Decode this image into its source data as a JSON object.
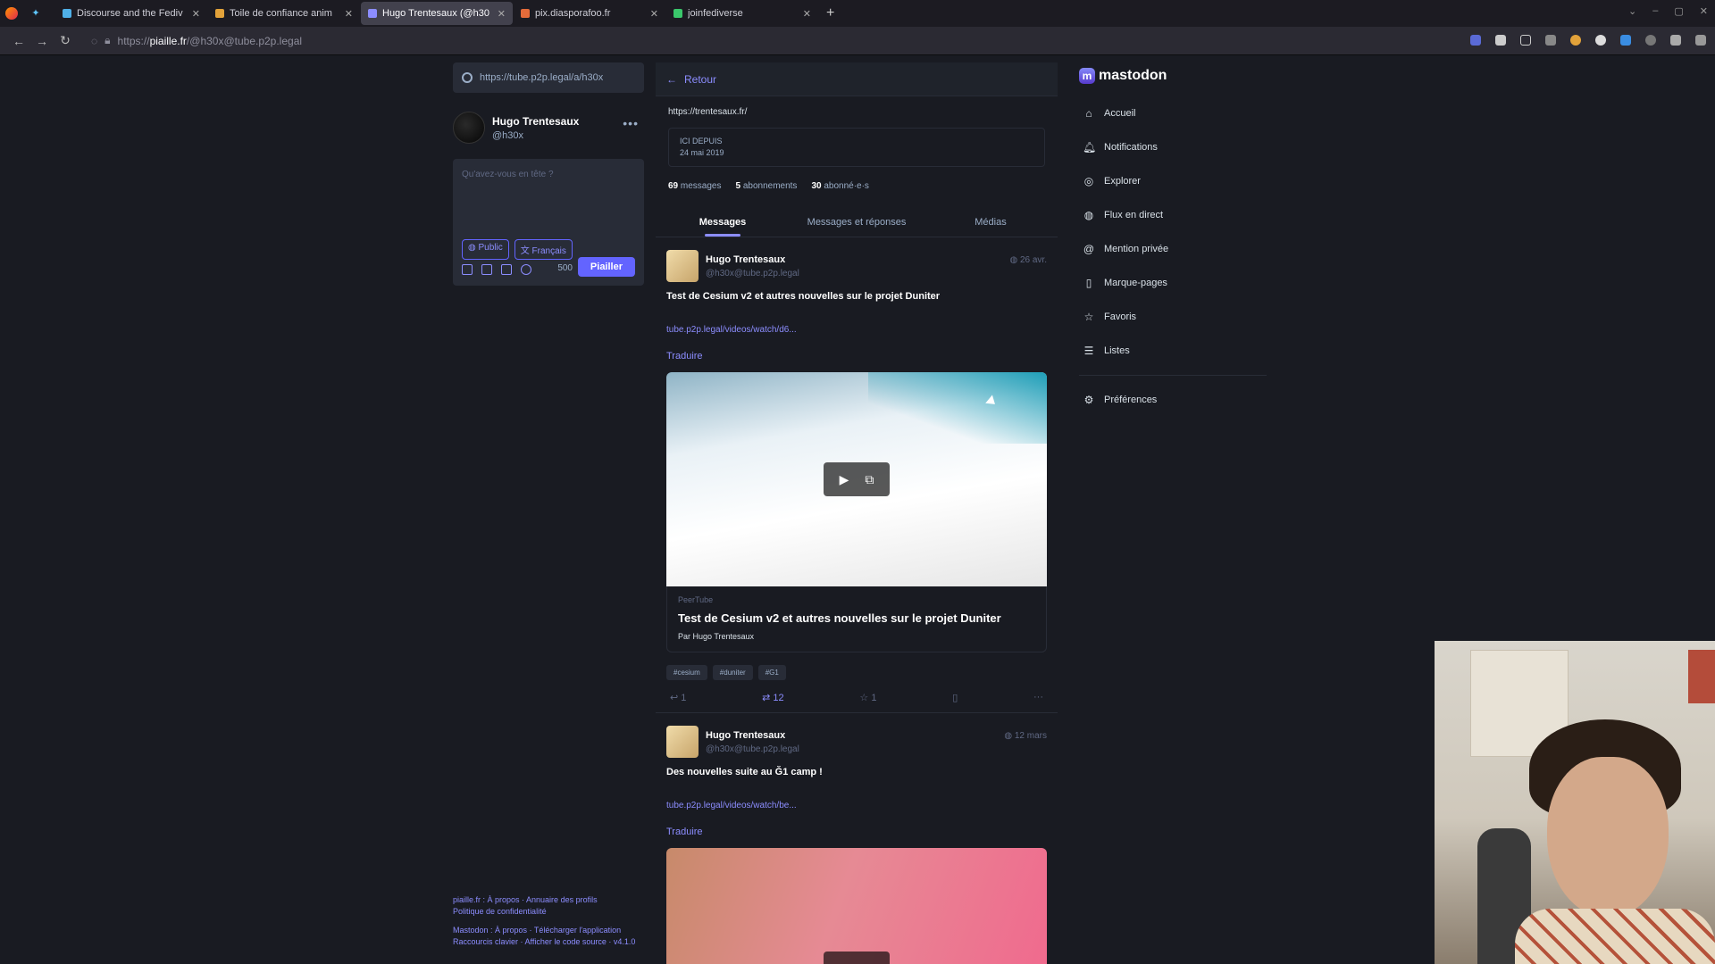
{
  "browser": {
    "tabs": [
      {
        "title": "Discourse and the Fediv",
        "color": "#4fb0e8",
        "active": false
      },
      {
        "title": "Toile de confiance anim",
        "color": "#e2a23a",
        "active": false
      },
      {
        "title": "Hugo Trentesaux (@h30",
        "color": "#8c8dff",
        "active": true
      },
      {
        "title": "pix.diasporafoo.fr",
        "color": "#e46b3a",
        "active": false
      },
      {
        "title": "joinfediverse",
        "color": "#3ac76b",
        "active": false
      }
    ],
    "url_prefix": "https://",
    "url_host": "piaille.fr",
    "url_path": "/@h30x@tube.p2p.legal"
  },
  "left": {
    "search_value": "https://tube.p2p.legal/a/h30x",
    "user_name": "Hugo Trentesaux",
    "user_handle": "@h30x",
    "compose_placeholder": "Qu'avez-vous en tête ?",
    "visibility": "Public",
    "language": "Français",
    "char_count": "500",
    "post_button": "Piailler"
  },
  "footer": {
    "line1": "piaille.fr : À propos · Annuaire des profils",
    "line2": "Politique de confidentialité",
    "line3": "Mastodon : À propos · Télécharger l'application",
    "line4": "Raccourcis clavier · Afficher le code source · v4.1.0"
  },
  "profile": {
    "back_label": "Retour",
    "url": "https://trentesaux.fr/",
    "joined_label": "ICI DEPUIS",
    "joined_date": "24 mai 2019",
    "posts_count": "69",
    "posts_label": "messages",
    "following_count": "5",
    "following_label": "abonnements",
    "followers_count": "30",
    "followers_label": "abonné·e·s",
    "tabs": [
      "Messages",
      "Messages et réponses",
      "Médias"
    ]
  },
  "statuses": [
    {
      "author": "Hugo Trentesaux",
      "handle": "@h30x@tube.p2p.legal",
      "time": "26 avr.",
      "text": "Test de Cesium v2 et autres nouvelles sur le projet Duniter",
      "link": "tube.p2p.legal/videos/watch/d6...",
      "translate": "Traduire",
      "card_source": "PeerTube",
      "card_title": "Test de Cesium v2 et autres nouvelles sur le projet Duniter",
      "card_by": "Par Hugo Trentesaux",
      "tags": [
        "#cesium",
        "#duniter",
        "#G1"
      ],
      "replies": "1",
      "boosts": "12",
      "favs": "1"
    },
    {
      "author": "Hugo Trentesaux",
      "handle": "@h30x@tube.p2p.legal",
      "time": "12 mars",
      "text": "Des nouvelles suite au Ğ1 camp !",
      "link": "tube.p2p.legal/videos/watch/be...",
      "translate": "Traduire"
    }
  ],
  "nav": {
    "brand": "mastodon",
    "items": [
      {
        "label": "Accueil",
        "icon": "home-icon"
      },
      {
        "label": "Notifications",
        "icon": "bell-icon"
      },
      {
        "label": "Explorer",
        "icon": "compass-icon"
      },
      {
        "label": "Flux en direct",
        "icon": "globe-icon"
      },
      {
        "label": "Mention privée",
        "icon": "at-icon"
      },
      {
        "label": "Marque-pages",
        "icon": "bookmark-icon"
      },
      {
        "label": "Favoris",
        "icon": "star-icon"
      },
      {
        "label": "Listes",
        "icon": "list-icon"
      }
    ],
    "preferences": "Préférences"
  }
}
